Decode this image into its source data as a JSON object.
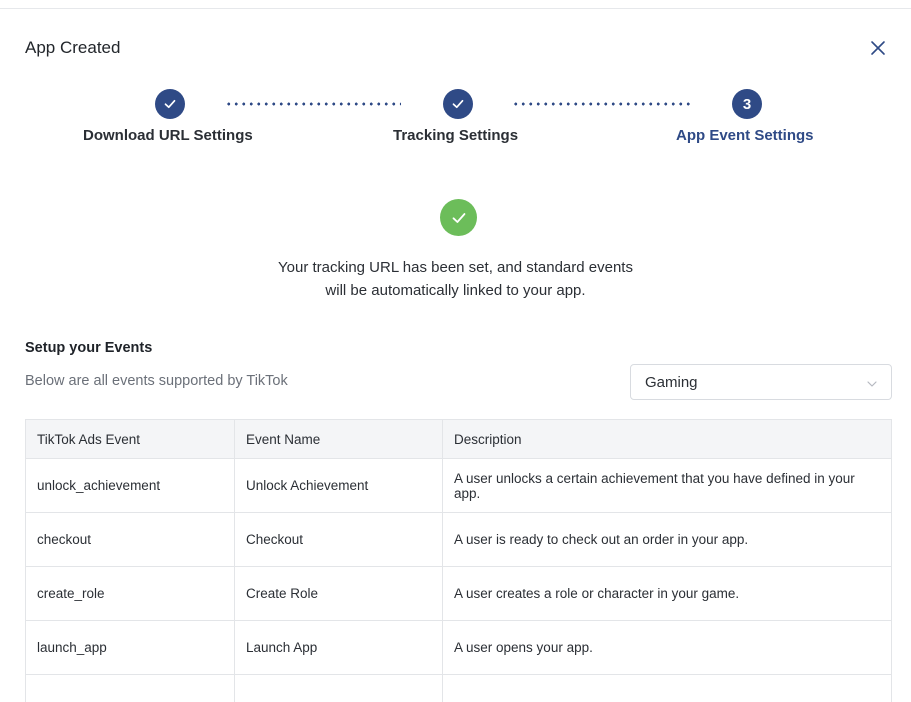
{
  "modal": {
    "title": "App Created"
  },
  "steps": [
    {
      "label": "Download URL Settings",
      "status": "complete"
    },
    {
      "label": "Tracking Settings",
      "status": "complete"
    },
    {
      "label": "App Event Settings",
      "status": "active",
      "number": "3"
    }
  ],
  "success": {
    "line1": "Your tracking URL has been set, and standard events",
    "line2": "will be automatically linked to your app."
  },
  "events": {
    "title": "Setup your Events",
    "subtitle": "Below are all events supported by TikTok",
    "category": {
      "selected": "Gaming"
    },
    "table": {
      "headers": [
        "TikTok Ads Event",
        "Event Name",
        "Description"
      ],
      "rows": [
        [
          "unlock_achievement",
          "Unlock Achievement",
          "A user unlocks a certain achievement that you have defined in your app."
        ],
        [
          "checkout",
          "Checkout",
          "A user is ready to check out an order in your app."
        ],
        [
          "create_role",
          "Create Role",
          "A user creates a role or character in your game."
        ],
        [
          "launch_app",
          "Launch App",
          "A user opens your app."
        ],
        [
          "",
          "",
          ""
        ]
      ]
    }
  },
  "colors": {
    "primary": "#2f4a86",
    "success": "#6cbd5a",
    "border": "#e3e5e8",
    "header_bg": "#f4f5f7"
  }
}
